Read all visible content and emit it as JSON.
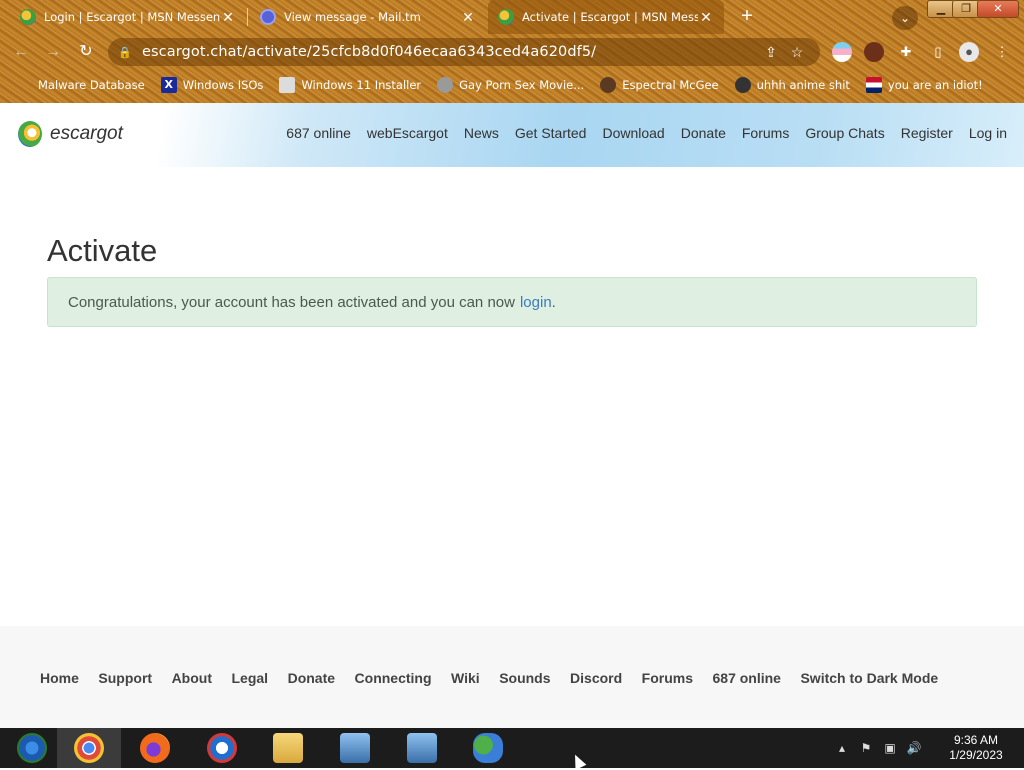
{
  "browser": {
    "tabs": [
      {
        "title": "Login | Escargot | MSN Messenger",
        "icon": "escargot-icon",
        "active": false
      },
      {
        "title": "View message - Mail.tm",
        "icon": "mail-icon",
        "active": false
      },
      {
        "title": "Activate | Escargot | MSN Messenger",
        "icon": "escargot-icon",
        "active": true
      }
    ],
    "new_tab_glyph": "+",
    "url": "escargot.chat/activate/25cfcb8d0f046ecaa6343ced4a620df5/",
    "bookmarks": [
      {
        "label": "Malware Database",
        "icon": "folder-icon"
      },
      {
        "label": "Windows ISOs",
        "icon": "x-icon"
      },
      {
        "label": "Windows 11 Installer",
        "icon": "image-icon"
      },
      {
        "label": "Gay Porn Sex Movie...",
        "icon": "disc-icon"
      },
      {
        "label": "Espectral McGee",
        "icon": "avatar-icon"
      },
      {
        "label": "uhhh anime shit",
        "icon": "anime-icon"
      },
      {
        "label": "you are an idiot!",
        "icon": "flag-icon"
      }
    ]
  },
  "site": {
    "logo_text": "escargot",
    "nav": [
      "687 online",
      "webEscargot",
      "News",
      "Get Started",
      "Download",
      "Donate",
      "Forums",
      "Group Chats",
      "Register",
      "Log in"
    ],
    "page_title": "Activate",
    "alert": {
      "text": "Congratulations, your account has been activated and you can now",
      "link": "login",
      "suffix": "."
    },
    "footer": [
      "Home",
      "Support",
      "About",
      "Legal",
      "Donate",
      "Connecting",
      "Wiki",
      "Sounds",
      "Discord",
      "Forums",
      "687 online",
      "Switch to Dark Mode"
    ]
  },
  "taskbar": {
    "apps": [
      "start-orb",
      "chrome",
      "firefox",
      "edge",
      "file-explorer",
      "installer",
      "installer",
      "messenger"
    ],
    "clock": {
      "time": "9:36 AM",
      "date": "1/29/2023"
    }
  },
  "colors": {
    "accent_link": "#3b7bc2",
    "alert_bg": "#dff0e2",
    "footer_bg": "#f7f7f7"
  }
}
